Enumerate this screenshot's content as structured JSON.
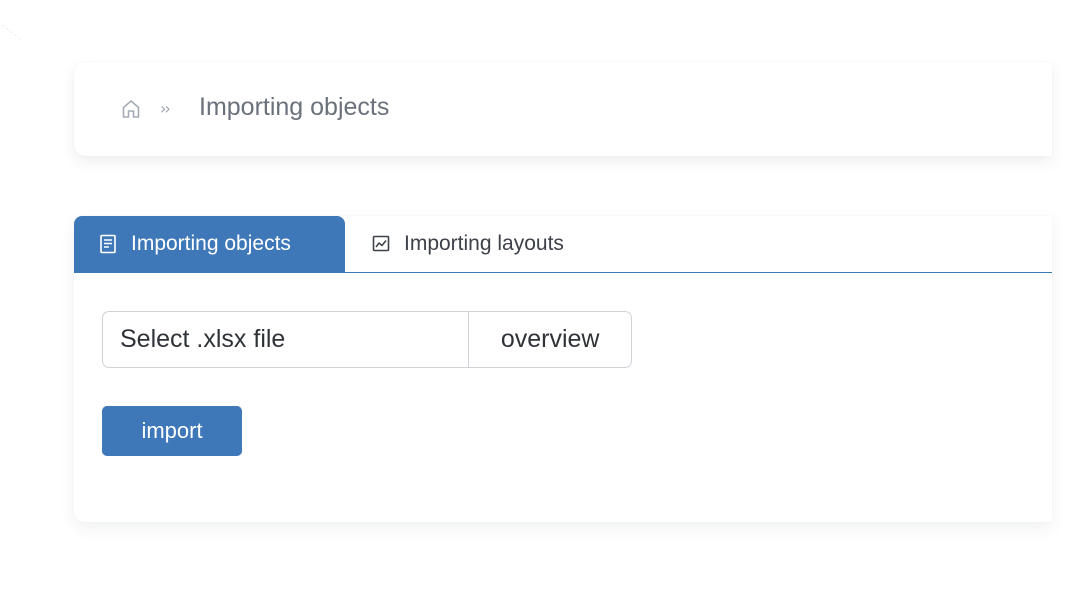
{
  "breadcrumb": {
    "home_icon": "home-icon",
    "separator": "››",
    "current": "Importing objects"
  },
  "tabs": [
    {
      "label": "Importing objects",
      "icon": "document-list-icon",
      "active": true
    },
    {
      "label": "Importing layouts",
      "icon": "image-chart-icon",
      "active": false
    }
  ],
  "import_form": {
    "file_placeholder": "Select .xlsx file",
    "browse_label": "overview",
    "import_label": "import"
  },
  "colors": {
    "accent": "#3f78b8",
    "text": "#2f3338",
    "muted": "#6b717b",
    "border": "#cfd3d8"
  }
}
